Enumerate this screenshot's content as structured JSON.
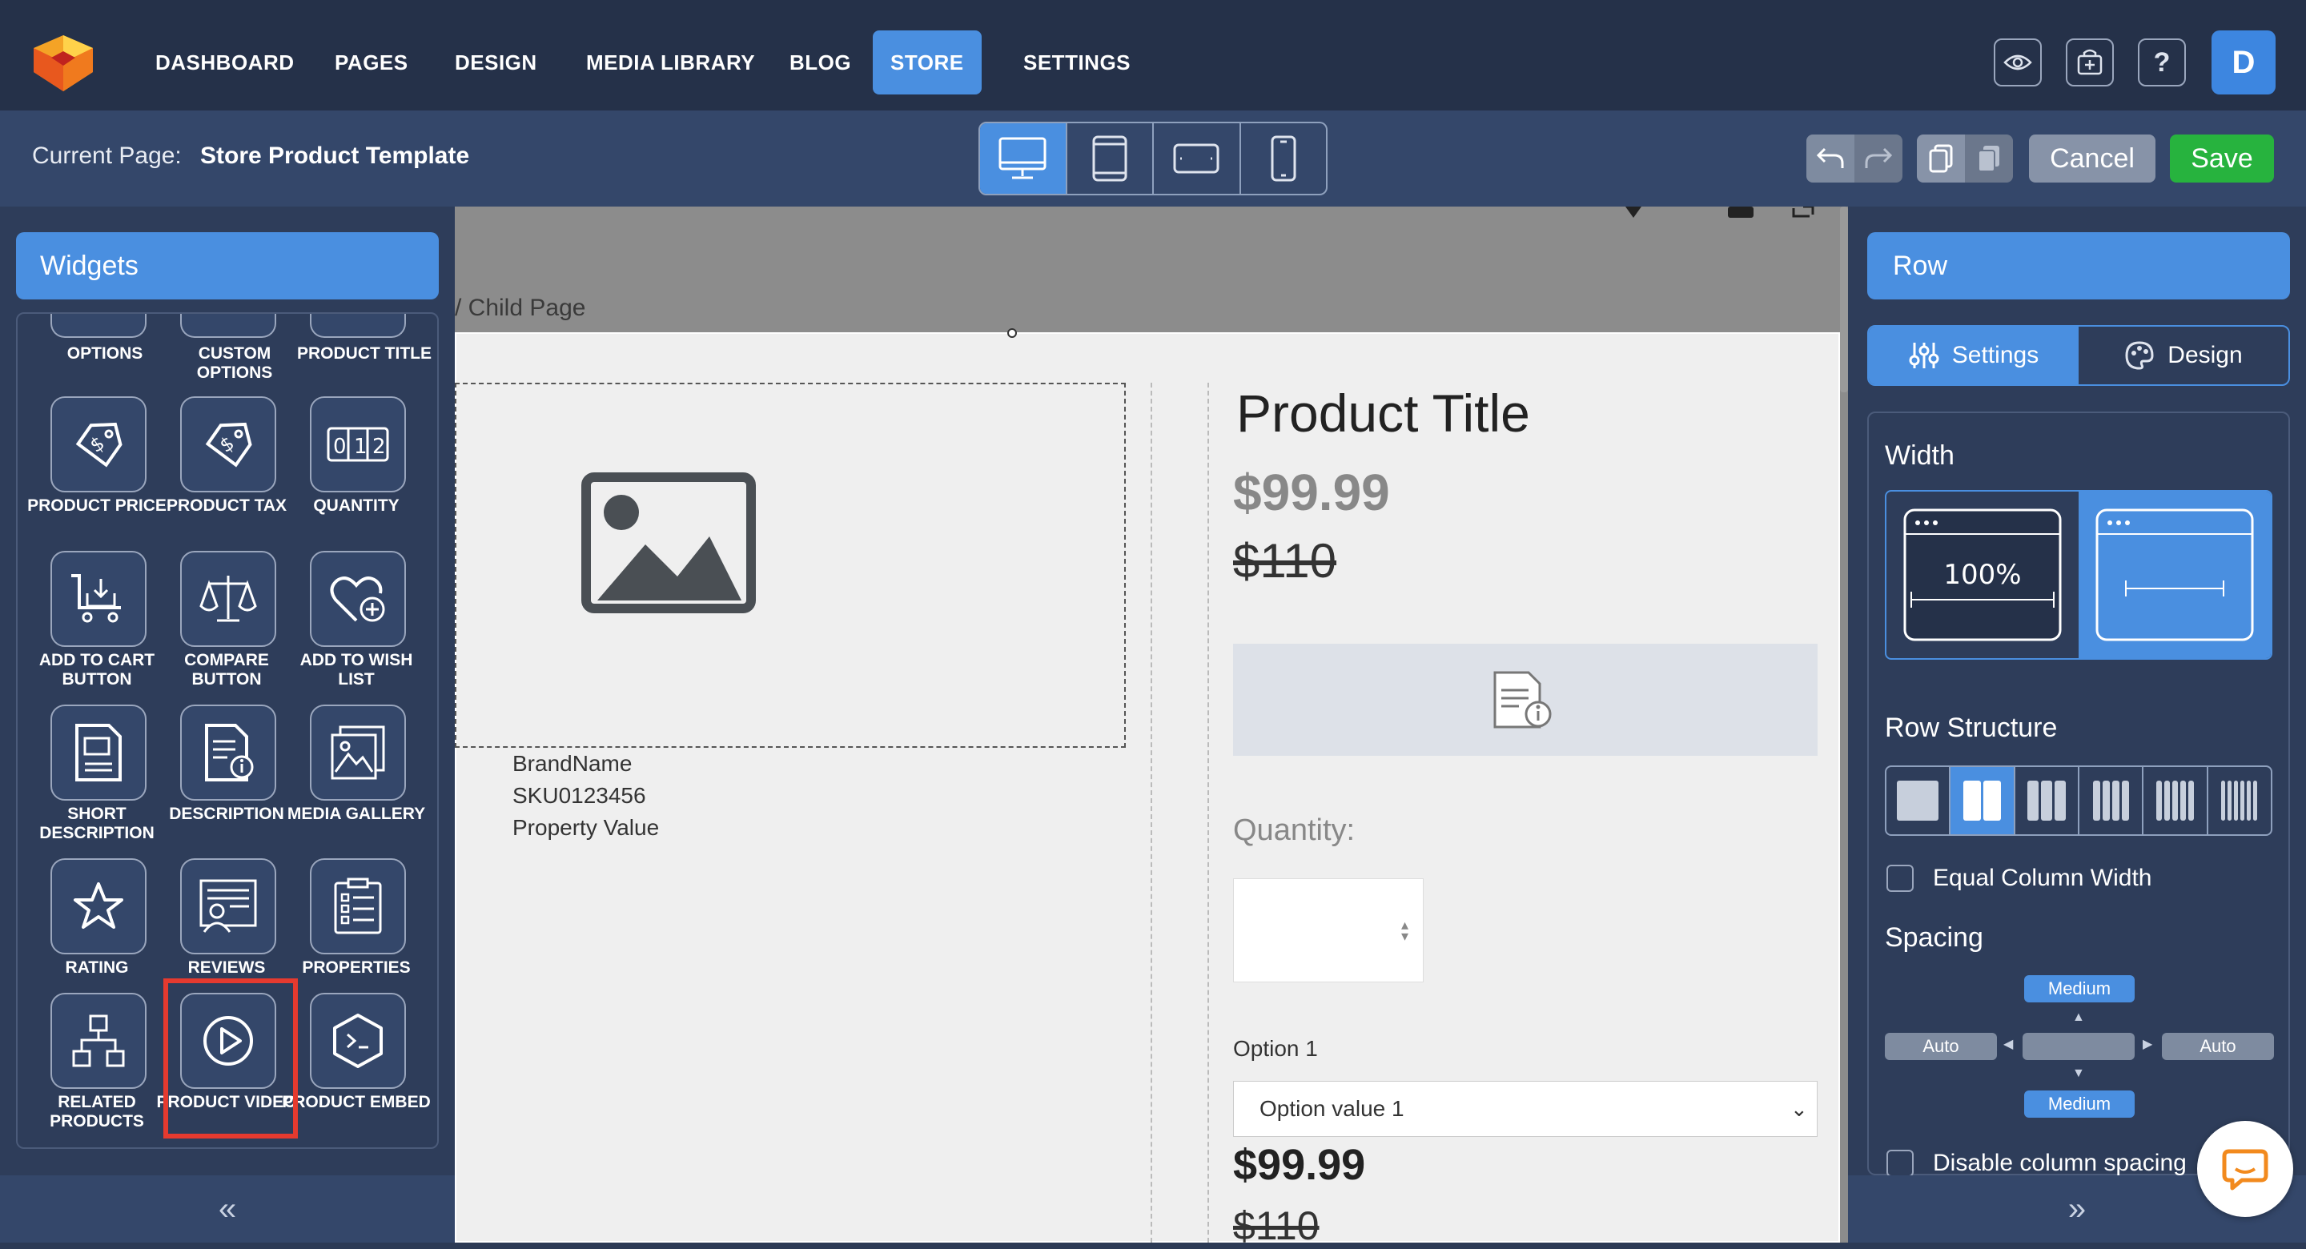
{
  "nav": {
    "items": [
      "DASHBOARD",
      "PAGES",
      "DESIGN",
      "MEDIA LIBRARY",
      "BLOG",
      "STORE",
      "SETTINGS"
    ],
    "active": "STORE",
    "avatar_initial": "D"
  },
  "subbar": {
    "current_page_label": "Current Page:",
    "current_page_name": "Store Product Template",
    "device_active": "desktop",
    "cancel_label": "Cancel",
    "save_label": "Save"
  },
  "widgets": {
    "header": "Widgets",
    "items": [
      {
        "label": "OPTIONS",
        "icon": "options-icon"
      },
      {
        "label": "CUSTOM OPTIONS",
        "icon": "custom-options-icon"
      },
      {
        "label": "PRODUCT TITLE",
        "icon": "product-title-icon"
      },
      {
        "label": "PRODUCT PRICE",
        "icon": "price-tag-icon"
      },
      {
        "label": "PRODUCT TAX",
        "icon": "tax-tag-icon"
      },
      {
        "label": "QUANTITY",
        "icon": "quantity-icon"
      },
      {
        "label": "ADD TO CART BUTTON",
        "icon": "cart-icon"
      },
      {
        "label": "COMPARE BUTTON",
        "icon": "scale-icon"
      },
      {
        "label": "ADD TO WISH LIST",
        "icon": "heart-plus-icon"
      },
      {
        "label": "SHORT DESCRIPTION",
        "icon": "document-icon"
      },
      {
        "label": "DESCRIPTION",
        "icon": "document-info-icon"
      },
      {
        "label": "MEDIA GALLERY",
        "icon": "gallery-icon"
      },
      {
        "label": "RATING",
        "icon": "star-icon"
      },
      {
        "label": "REVIEWS",
        "icon": "reviews-icon"
      },
      {
        "label": "PROPERTIES",
        "icon": "clipboard-list-icon"
      },
      {
        "label": "RELATED PRODUCTS",
        "icon": "hierarchy-icon"
      },
      {
        "label": "PRODUCT VIDEO",
        "icon": "play-icon"
      },
      {
        "label": "PRODUCT EMBED",
        "icon": "code-hexagon-icon"
      }
    ],
    "highlighted": "PRODUCT VIDEO"
  },
  "canvas": {
    "breadcrumb": "/  Child Page",
    "brand": "BrandName",
    "sku": "SKU0123456",
    "property": "Property Value",
    "product_title": "Product Title",
    "price": "$99.99",
    "old_price": "$110",
    "quantity_label": "Quantity:",
    "option_label": "Option 1",
    "option_value": "Option value 1",
    "price_bottom": "$99.99",
    "old_price_bottom": "$110"
  },
  "right_panel": {
    "header": "Row",
    "tabs": [
      "Settings",
      "Design"
    ],
    "active_tab": "Settings",
    "width_heading": "Width",
    "width_full_label": "100%",
    "width_selected": "boxed",
    "row_structure_heading": "Row Structure",
    "row_structure_selected_columns": 2,
    "equal_column_width_label": "Equal Column Width",
    "equal_column_width_checked": false,
    "spacing_heading": "Spacing",
    "spacing_top": "Medium",
    "spacing_bottom": "Medium",
    "spacing_left": "Auto",
    "spacing_right": "Auto",
    "disable_spacing_label": "Disable column spacing",
    "disable_spacing_checked": false
  },
  "colors": {
    "accent": "#4a8fe0",
    "save": "#27b33e",
    "highlight": "#e53a2f",
    "topbar": "#253149"
  }
}
